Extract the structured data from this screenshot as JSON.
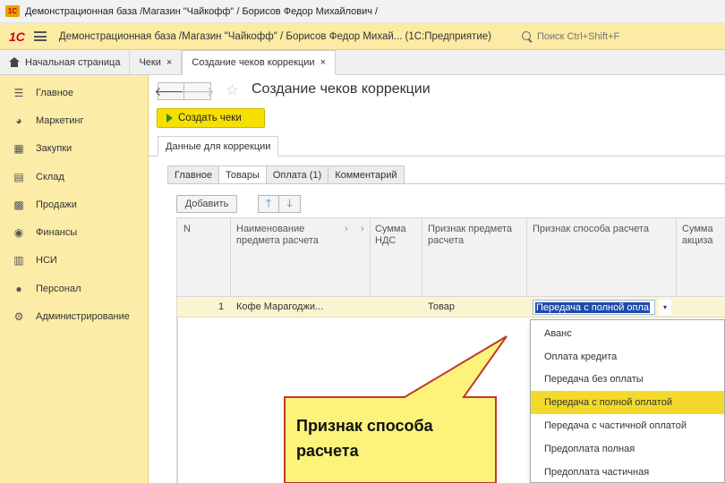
{
  "window": {
    "title": "Демонстрационная база /Магазин \"Чайкофф\" / Борисов Федор Михайлович /"
  },
  "appbar": {
    "logo": "1С",
    "title": "Демонстрационная база /Магазин \"Чайкофф\" / Борисов Федор Михай...   (1С:Предприятие)",
    "search_placeholder": "Поиск Ctrl+Shift+F"
  },
  "tabs": [
    {
      "label": "Начальная страница",
      "icon": "home-icon"
    },
    {
      "label": "Чеки",
      "close": "×"
    },
    {
      "label": "Создание чеков коррекции",
      "close": "×",
      "active": true
    }
  ],
  "sidebar": {
    "items": [
      {
        "label": "Главное",
        "icon": "menu-icon"
      },
      {
        "label": "Маркетинг",
        "icon": "marketing-icon"
      },
      {
        "label": "Закупки",
        "icon": "purchases-icon"
      },
      {
        "label": "Склад",
        "icon": "warehouse-icon"
      },
      {
        "label": "Продажи",
        "icon": "sales-icon"
      },
      {
        "label": "Финансы",
        "icon": "finance-icon"
      },
      {
        "label": "НСИ",
        "icon": "reference-icon"
      },
      {
        "label": "Персонал",
        "icon": "person-icon"
      },
      {
        "label": "Администрирование",
        "icon": "gear-icon"
      }
    ]
  },
  "form": {
    "back": "🡐",
    "forward": "🡒",
    "star": "☆",
    "title": "Создание чеков коррекции",
    "create_button": "Создать чеки",
    "section_tab": "Данные для коррекции",
    "subtabs": [
      "Главное",
      "Товары",
      "Оплата (1)",
      "Комментарий"
    ],
    "add_button": "Добавить",
    "up": "🡑",
    "down": "🡓"
  },
  "table": {
    "columns": {
      "n": "N",
      "name": "Наименование предмета расчета",
      "vat": "Сумма НДС",
      "subject_sign": "Признак предмета расчета",
      "payment_method": "Признак способа расчета",
      "excise": "Сумма акциза"
    },
    "rows": [
      {
        "n": "1",
        "name": "Кофе Марагоджи...",
        "subject_sign": "Товар",
        "payment_method": "Передача с полной опла"
      }
    ],
    "dropdown_arrow": "▾"
  },
  "dropdown": {
    "items": [
      "Аванс",
      "Оплата кредита",
      "Передача без оплаты",
      "Передача с полной оплатой",
      "Передача с частичной оплатой",
      "Предоплата полная",
      "Предоплата частичная"
    ],
    "selected_index": 3
  },
  "callout": {
    "line1": "Признак способа",
    "line2": "расчета",
    "fill": "#fbf37a",
    "stroke": "#c0392b"
  },
  "colors": {
    "sidebar": "#fbeca8",
    "create_button": "#f6e000",
    "selection": "#1f4aa8",
    "dropdown_selected": "#f3d92b"
  }
}
